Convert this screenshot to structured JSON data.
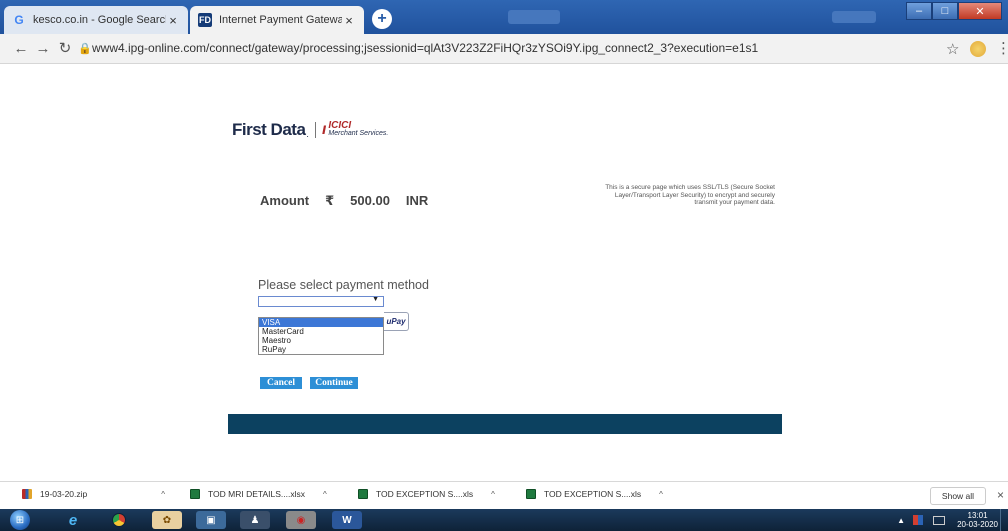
{
  "browser": {
    "tabs": [
      {
        "title": "kesco.co.in - Google Search",
        "favicon": "G",
        "close": "×"
      },
      {
        "title": "Internet Payment Gateway",
        "favicon": "FD",
        "close": "×"
      }
    ],
    "new_tab": "+",
    "address": {
      "url": "www4.ipg-online.com/connect/gateway/processing;jsessionid=qlAt3V223Z2FiHQr3zYSOi9Y.ipg_connect2_3?execution=e1s1"
    }
  },
  "page": {
    "logo": {
      "first_data": "First Data",
      "first_data_dot": ".",
      "icici_top": "ICICI",
      "icici_bottom": "Merchant Services."
    },
    "amount": {
      "label": "Amount",
      "currency_symbol": "₹",
      "value": "500.00",
      "currency": "INR"
    },
    "secure_note": "This is a secure page which uses SSL/TLS (Secure Socket Layer/Transport Layer Security) to encrypt and securely transmit your payment data.",
    "payment": {
      "label": "Please select payment method",
      "options": [
        "VISA",
        "MasterCard",
        "Maestro",
        "RuPay"
      ],
      "highlighted": "VISA",
      "card_logo_text": "uPay"
    },
    "buttons": {
      "cancel": "Cancel",
      "continue": "Continue"
    }
  },
  "downloads": {
    "items": [
      {
        "name": "19-03-20.zip",
        "type": "zip"
      },
      {
        "name": "TOD MRI DETAILS....xlsx",
        "type": "excel"
      },
      {
        "name": "TOD EXCEPTION S....xls",
        "type": "excel"
      },
      {
        "name": "TOD EXCEPTION S....xls",
        "type": "excel"
      }
    ],
    "show_all": "Show all",
    "close": "×"
  },
  "taskbar": {
    "clock_time": "13:01",
    "clock_date": "20-03-2020"
  }
}
